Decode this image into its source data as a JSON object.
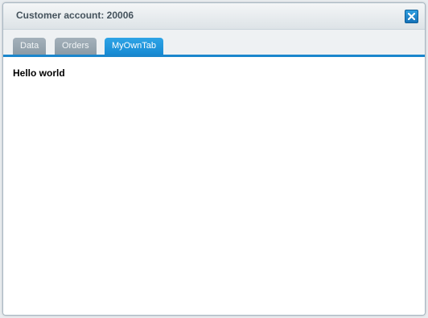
{
  "window": {
    "title": "Customer account: 20006",
    "close_icon": "close-icon"
  },
  "tabs": [
    {
      "label": "Data",
      "active": false
    },
    {
      "label": "Orders",
      "active": false
    },
    {
      "label": "MyOwnTab",
      "active": true
    }
  ],
  "content": {
    "text": "Hello world"
  },
  "colors": {
    "accent": "#1a86cc",
    "inactive_tab": "#98a6b1",
    "title_text": "#44525c"
  }
}
